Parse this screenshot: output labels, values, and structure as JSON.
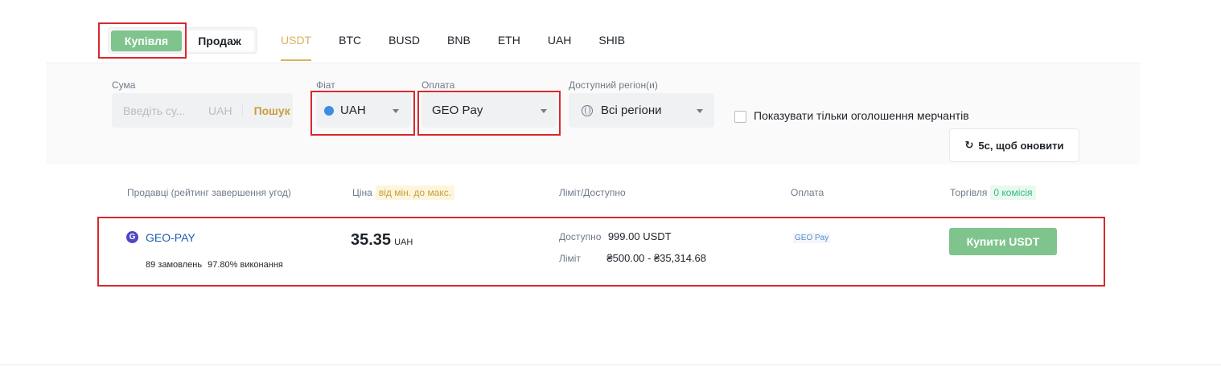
{
  "trade_type": {
    "buy_label": "Купівля",
    "sell_label": "Продаж"
  },
  "assets": [
    "USDT",
    "BTC",
    "BUSD",
    "BNB",
    "ETH",
    "UAH",
    "SHIB"
  ],
  "active_asset": "USDT",
  "filters": {
    "amount": {
      "label": "Сума",
      "placeholder": "Введіть су...",
      "currency": "UAH",
      "search_label": "Пошук"
    },
    "fiat": {
      "label": "Фіат",
      "value": "UAH"
    },
    "payment": {
      "label": "Оплата",
      "value": "GEO Pay"
    },
    "region": {
      "label": "Доступний регіон(и)",
      "value": "Всі регіони"
    },
    "merchant_only_label": "Показувати тільки оголошення мерчантів",
    "refresh_label": "5с, щоб оновити"
  },
  "table": {
    "headers": {
      "seller": "Продавці (рейтинг завершення угод)",
      "price": "Ціна",
      "price_sort": "від мін. до макс.",
      "limit": "Ліміт/Доступно",
      "payment": "Оплата",
      "trade": "Торгівля",
      "fee_tag": "0 комісія"
    },
    "rows": [
      {
        "avatar_letter": "G",
        "merchant": "GEO-PAY",
        "orders": "89 замовлень",
        "completion": "97.80% виконання",
        "price": "35.35",
        "price_currency": "UAH",
        "available_label": "Доступно",
        "available": "999.00 USDT",
        "limit_label": "Ліміт",
        "limit": "₴500.00 - ₴35,314.68",
        "payment_method": "GEO Pay",
        "buy_label": "Купити USDT"
      }
    ]
  },
  "colors": {
    "accent": "#d8b45c",
    "buy_green": "#7fc48d",
    "highlight_red": "#d9272e",
    "merchant_blue": "#1c5eb0"
  }
}
